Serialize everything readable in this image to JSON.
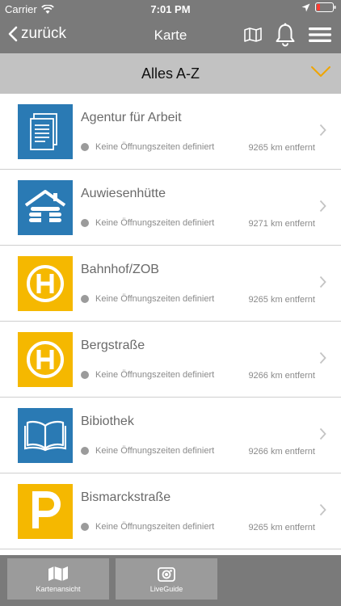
{
  "status_bar": {
    "carrier": "Carrier",
    "time": "7:01 PM"
  },
  "nav": {
    "back_label": "zurück",
    "title": "Karte"
  },
  "filter": {
    "label": "Alles A-Z"
  },
  "colors": {
    "blue": "#2a7ab4",
    "yellow": "#f5b800",
    "header": "#7a7a7a",
    "filter": "#c2c2c2"
  },
  "items": [
    {
      "title": "Agentur für Arbeit",
      "status": "Keine Öffnungszeiten definiert",
      "distance": "9265 km entfernt",
      "icon": "document-icon"
    },
    {
      "title": "Auwiesenhütte",
      "status": "Keine Öffnungszeiten definiert",
      "distance": "9271 km entfernt",
      "icon": "cabin-icon"
    },
    {
      "title": "Bahnhof/ZOB",
      "status": "Keine Öffnungszeiten definiert",
      "distance": "9265 km entfernt",
      "icon": "bus-stop-icon"
    },
    {
      "title": "Bergstraße",
      "status": "Keine Öffnungszeiten definiert",
      "distance": "9266 km entfernt",
      "icon": "bus-stop-icon"
    },
    {
      "title": "Bibiothek",
      "status": "Keine Öffnungszeiten definiert",
      "distance": "9266 km entfernt",
      "icon": "book-icon"
    },
    {
      "title": "Bismarckstraße",
      "status": "Keine Öffnungszeiten definiert",
      "distance": "9265 km entfernt",
      "icon": "parking-icon"
    }
  ],
  "tabs": [
    {
      "label": "Kartenansicht",
      "icon": "map-icon"
    },
    {
      "label": "LiveGuide",
      "icon": "camera-icon"
    }
  ]
}
